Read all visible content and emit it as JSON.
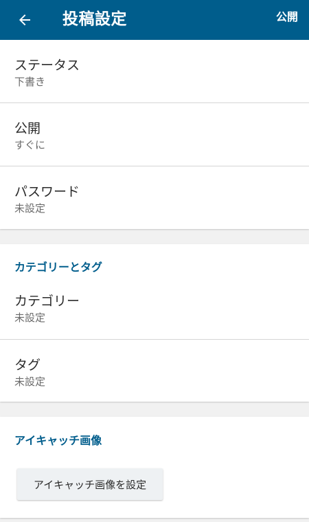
{
  "app_bar": {
    "title": "投稿設定",
    "action_label": "公開",
    "back_icon": "arrow-left-icon",
    "background_color": "#005d8c"
  },
  "general": {
    "rows": [
      {
        "label": "ステータス",
        "value": "下書き"
      },
      {
        "label": "公開",
        "value": "すぐに"
      },
      {
        "label": "パスワード",
        "value": "未設定"
      }
    ]
  },
  "categories_tags": {
    "header": "カテゴリーとタグ",
    "rows": [
      {
        "label": "カテゴリー",
        "value": "未設定"
      },
      {
        "label": "タグ",
        "value": "未設定"
      }
    ]
  },
  "featured_image": {
    "header": "アイキャッチ画像",
    "button_label": "アイキャッチ画像を設定"
  },
  "colors": {
    "accent": "#005d8c",
    "background": "#f1f1f1",
    "card": "#ffffff"
  }
}
